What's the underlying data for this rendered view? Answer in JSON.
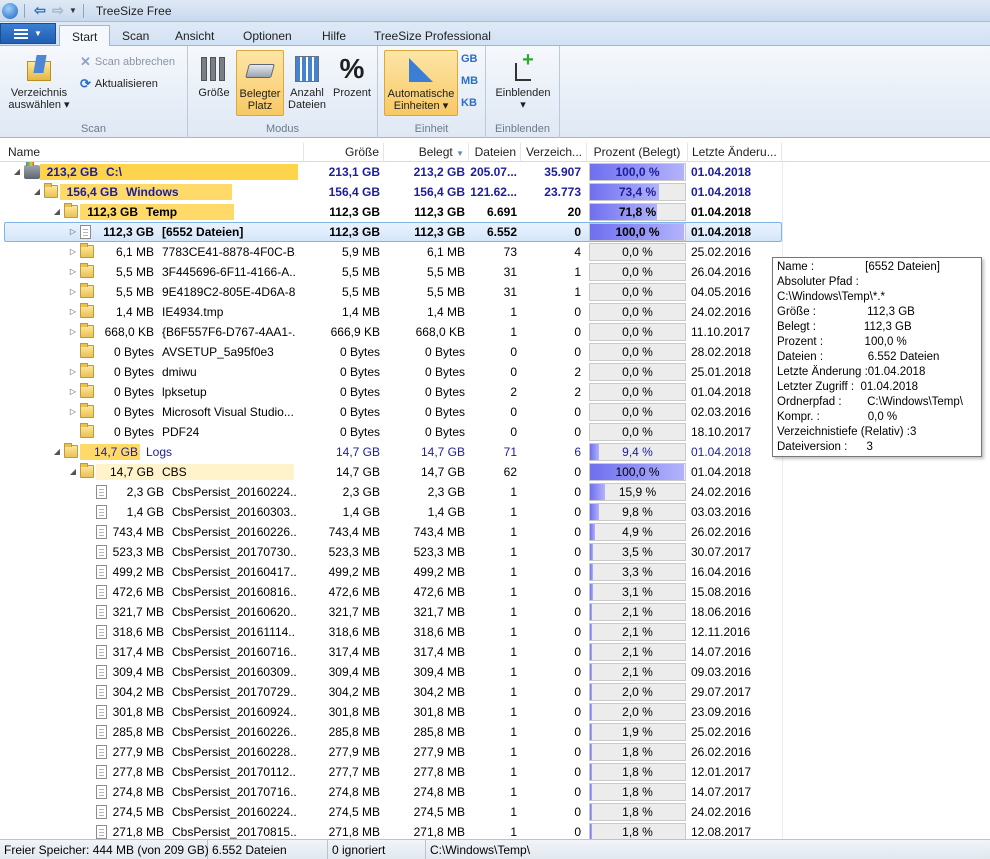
{
  "window": {
    "title": "TreeSize Free"
  },
  "ribbon_tabs": [
    "Start",
    "Scan",
    "Ansicht",
    "Optionen",
    "Hilfe",
    "TreeSize Professional"
  ],
  "active_tab": "Start",
  "ribbon": {
    "scan_group": {
      "label": "Scan",
      "choose_dir": "Verzeichnis\nauswählen",
      "choose_dir_l1": "Verzeichnis",
      "choose_dir_l2": "auswählen",
      "cancel_scan": "Scan abbrechen",
      "refresh": "Aktualisieren"
    },
    "mode_group": {
      "label": "Modus",
      "size": "Größe",
      "allocated_l1": "Belegter",
      "allocated_l2": "Platz",
      "count_l1": "Anzahl",
      "count_l2": "Dateien",
      "percent": "Prozent"
    },
    "unit_group": {
      "label": "Einheit",
      "auto_l1": "Automatische",
      "auto_l2": "Einheiten",
      "gb": "GB",
      "mb": "MB",
      "kb": "KB"
    },
    "show_group": {
      "label": "Einblenden",
      "show": "Einblenden"
    }
  },
  "columns": [
    "Name",
    "Größe",
    "Belegt",
    "Dateien",
    "Verzeich...",
    "Prozent (Belegt)",
    "Letzte Änderu..."
  ],
  "rows": [
    {
      "size_label": "213,2 GB",
      "name": "C:\\",
      "size": "213,1 GB",
      "alloc": "213,2 GB",
      "files": "205.07...",
      "dirs": "35.907",
      "pct": 100.0,
      "pct_text": "100,0 %",
      "date": "01.04.2018"
    },
    {
      "size_label": "156,4 GB",
      "name": "Windows",
      "size": "156,4 GB",
      "alloc": "156,4 GB",
      "files": "121.62...",
      "dirs": "23.773",
      "pct": 73.4,
      "pct_text": "73,4 %",
      "date": "01.04.2018"
    },
    {
      "size_label": "112,3 GB",
      "name": "Temp",
      "size": "112,3 GB",
      "alloc": "112,3 GB",
      "files": "6.691",
      "dirs": "20",
      "pct": 71.8,
      "pct_text": "71,8 %",
      "date": "01.04.2018"
    },
    {
      "size_label": "112,3 GB",
      "name": "[6552 Dateien]",
      "size": "112,3 GB",
      "alloc": "112,3 GB",
      "files": "6.552",
      "dirs": "0",
      "pct": 100.0,
      "pct_text": "100,0 %",
      "date": "01.04.2018"
    },
    {
      "size_label": "6,1 MB",
      "name": "7783CE41-8878-4F0C-B...",
      "size": "5,9 MB",
      "alloc": "6,1 MB",
      "files": "73",
      "dirs": "4",
      "pct": 0.0,
      "pct_text": "0,0 %",
      "date": "25.02.2016"
    },
    {
      "size_label": "5,5 MB",
      "name": "3F445696-6F11-4166-A...",
      "size": "5,5 MB",
      "alloc": "5,5 MB",
      "files": "31",
      "dirs": "1",
      "pct": 0.0,
      "pct_text": "0,0 %",
      "date": "26.04.2016"
    },
    {
      "size_label": "5,5 MB",
      "name": "9E4189C2-805E-4D6A-8...",
      "size": "5,5 MB",
      "alloc": "5,5 MB",
      "files": "31",
      "dirs": "1",
      "pct": 0.0,
      "pct_text": "0,0 %",
      "date": "04.05.2016"
    },
    {
      "size_label": "1,4 MB",
      "name": "IE4934.tmp",
      "size": "1,4 MB",
      "alloc": "1,4 MB",
      "files": "1",
      "dirs": "0",
      "pct": 0.0,
      "pct_text": "0,0 %",
      "date": "24.02.2016"
    },
    {
      "size_label": "668,0 KB",
      "name": "{B6F557F6-D767-4AA1-...",
      "size": "666,9 KB",
      "alloc": "668,0 KB",
      "files": "1",
      "dirs": "0",
      "pct": 0.0,
      "pct_text": "0,0 %",
      "date": "11.10.2017"
    },
    {
      "size_label": "0 Bytes",
      "name": "AVSETUP_5a95f0e3",
      "size": "0 Bytes",
      "alloc": "0 Bytes",
      "files": "0",
      "dirs": "0",
      "pct": 0.0,
      "pct_text": "0,0 %",
      "date": "28.02.2018"
    },
    {
      "size_label": "0 Bytes",
      "name": "dmiwu",
      "size": "0 Bytes",
      "alloc": "0 Bytes",
      "files": "0",
      "dirs": "2",
      "pct": 0.0,
      "pct_text": "0,0 %",
      "date": "25.01.2018"
    },
    {
      "size_label": "0 Bytes",
      "name": "lpksetup",
      "size": "0 Bytes",
      "alloc": "0 Bytes",
      "files": "2",
      "dirs": "2",
      "pct": 0.0,
      "pct_text": "0,0 %",
      "date": "01.04.2018"
    },
    {
      "size_label": "0 Bytes",
      "name": "Microsoft Visual Studio...",
      "size": "0 Bytes",
      "alloc": "0 Bytes",
      "files": "0",
      "dirs": "0",
      "pct": 0.0,
      "pct_text": "0,0 %",
      "date": "02.03.2016"
    },
    {
      "size_label": "0 Bytes",
      "name": "PDF24",
      "size": "0 Bytes",
      "alloc": "0 Bytes",
      "files": "0",
      "dirs": "0",
      "pct": 0.0,
      "pct_text": "0,0 %",
      "date": "18.10.2017"
    },
    {
      "size_label": "14,7 GB",
      "name": "Logs",
      "size": "14,7 GB",
      "alloc": "14,7 GB",
      "files": "71",
      "dirs": "6",
      "pct": 9.4,
      "pct_text": "9,4 %",
      "date": "01.04.2018"
    },
    {
      "size_label": "14,7 GB",
      "name": "CBS",
      "size": "14,7 GB",
      "alloc": "14,7 GB",
      "files": "62",
      "dirs": "0",
      "pct": 100.0,
      "pct_text": "100,0 %",
      "date": "01.04.2018"
    },
    {
      "size_label": "2,3 GB",
      "name": "CbsPersist_20160224...",
      "size": "2,3 GB",
      "alloc": "2,3 GB",
      "files": "1",
      "dirs": "0",
      "pct": 15.9,
      "pct_text": "15,9 %",
      "date": "24.02.2016"
    },
    {
      "size_label": "1,4 GB",
      "name": "CbsPersist_20160303...",
      "size": "1,4 GB",
      "alloc": "1,4 GB",
      "files": "1",
      "dirs": "0",
      "pct": 9.8,
      "pct_text": "9,8 %",
      "date": "03.03.2016"
    },
    {
      "size_label": "743,4 MB",
      "name": "CbsPersist_20160226...",
      "size": "743,4 MB",
      "alloc": "743,4 MB",
      "files": "1",
      "dirs": "0",
      "pct": 4.9,
      "pct_text": "4,9 %",
      "date": "26.02.2016"
    },
    {
      "size_label": "523,3 MB",
      "name": "CbsPersist_20170730...",
      "size": "523,3 MB",
      "alloc": "523,3 MB",
      "files": "1",
      "dirs": "0",
      "pct": 3.5,
      "pct_text": "3,5 %",
      "date": "30.07.2017"
    },
    {
      "size_label": "499,2 MB",
      "name": "CbsPersist_20160417...",
      "size": "499,2 MB",
      "alloc": "499,2 MB",
      "files": "1",
      "dirs": "0",
      "pct": 3.3,
      "pct_text": "3,3 %",
      "date": "16.04.2016"
    },
    {
      "size_label": "472,6 MB",
      "name": "CbsPersist_20160816...",
      "size": "472,6 MB",
      "alloc": "472,6 MB",
      "files": "1",
      "dirs": "0",
      "pct": 3.1,
      "pct_text": "3,1 %",
      "date": "15.08.2016"
    },
    {
      "size_label": "321,7 MB",
      "name": "CbsPersist_20160620...",
      "size": "321,7 MB",
      "alloc": "321,7 MB",
      "files": "1",
      "dirs": "0",
      "pct": 2.1,
      "pct_text": "2,1 %",
      "date": "18.06.2016"
    },
    {
      "size_label": "318,6 MB",
      "name": "CbsPersist_20161114...",
      "size": "318,6 MB",
      "alloc": "318,6 MB",
      "files": "1",
      "dirs": "0",
      "pct": 2.1,
      "pct_text": "2,1 %",
      "date": "12.11.2016"
    },
    {
      "size_label": "317,4 MB",
      "name": "CbsPersist_20160716...",
      "size": "317,4 MB",
      "alloc": "317,4 MB",
      "files": "1",
      "dirs": "0",
      "pct": 2.1,
      "pct_text": "2,1 %",
      "date": "14.07.2016"
    },
    {
      "size_label": "309,4 MB",
      "name": "CbsPersist_20160309...",
      "size": "309,4 MB",
      "alloc": "309,4 MB",
      "files": "1",
      "dirs": "0",
      "pct": 2.1,
      "pct_text": "2,1 %",
      "date": "09.03.2016"
    },
    {
      "size_label": "304,2 MB",
      "name": "CbsPersist_20170729...",
      "size": "304,2 MB",
      "alloc": "304,2 MB",
      "files": "1",
      "dirs": "0",
      "pct": 2.0,
      "pct_text": "2,0 %",
      "date": "29.07.2017"
    },
    {
      "size_label": "301,8 MB",
      "name": "CbsPersist_20160924...",
      "size": "301,8 MB",
      "alloc": "301,8 MB",
      "files": "1",
      "dirs": "0",
      "pct": 2.0,
      "pct_text": "2,0 %",
      "date": "23.09.2016"
    },
    {
      "size_label": "285,8 MB",
      "name": "CbsPersist_20160226...",
      "size": "285,8 MB",
      "alloc": "285,8 MB",
      "files": "1",
      "dirs": "0",
      "pct": 1.9,
      "pct_text": "1,9 %",
      "date": "25.02.2016"
    },
    {
      "size_label": "277,9 MB",
      "name": "CbsPersist_20160228...",
      "size": "277,9 MB",
      "alloc": "277,9 MB",
      "files": "1",
      "dirs": "0",
      "pct": 1.8,
      "pct_text": "1,8 %",
      "date": "26.02.2016"
    },
    {
      "size_label": "277,8 MB",
      "name": "CbsPersist_20170112...",
      "size": "277,7 MB",
      "alloc": "277,8 MB",
      "files": "1",
      "dirs": "0",
      "pct": 1.8,
      "pct_text": "1,8 %",
      "date": "12.01.2017"
    },
    {
      "size_label": "274,8 MB",
      "name": "CbsPersist_20170716...",
      "size": "274,8 MB",
      "alloc": "274,8 MB",
      "files": "1",
      "dirs": "0",
      "pct": 1.8,
      "pct_text": "1,8 %",
      "date": "14.07.2017"
    },
    {
      "size_label": "274,5 MB",
      "name": "CbsPersist_20160224...",
      "size": "274,5 MB",
      "alloc": "274,5 MB",
      "files": "1",
      "dirs": "0",
      "pct": 1.8,
      "pct_text": "1,8 %",
      "date": "24.02.2016"
    },
    {
      "size_label": "271,8 MB",
      "name": "CbsPersist_20170815...",
      "size": "271,8 MB",
      "alloc": "271,8 MB",
      "files": "1",
      "dirs": "0",
      "pct": 1.8,
      "pct_text": "1,8 %",
      "date": "12.08.2017"
    }
  ],
  "tooltip": {
    "lines": [
      "Name :                [6552 Dateien]",
      "Absoluter Pfad :",
      "C:\\Windows\\Temp\\*.*",
      "Größe :                112,3 GB",
      "Belegt :               112,3 GB",
      "Prozent :             100,0 %",
      "Dateien :              6.552 Dateien",
      "Letzte Änderung :01.04.2018",
      "Letzter Zugriff :  01.04.2018",
      "Ordnerpfad :        C:\\Windows\\Temp\\",
      "Kompr. :               0,0 %",
      "Verzeichnistiefe (Relativ) :3",
      "Dateiversion :      3"
    ]
  },
  "status": {
    "free": "Freier Speicher: 444 MB  (von 209 GB)",
    "files": "6.552  Dateien",
    "ignored": "0 ignoriert",
    "path": "C:\\Windows\\Temp\\"
  },
  "colors": {
    "accent": "#1f5eb3",
    "bar_fill": "#8b8bf5",
    "tree_bar": "#ffd44d",
    "level1_text": "#1d1d9a"
  }
}
